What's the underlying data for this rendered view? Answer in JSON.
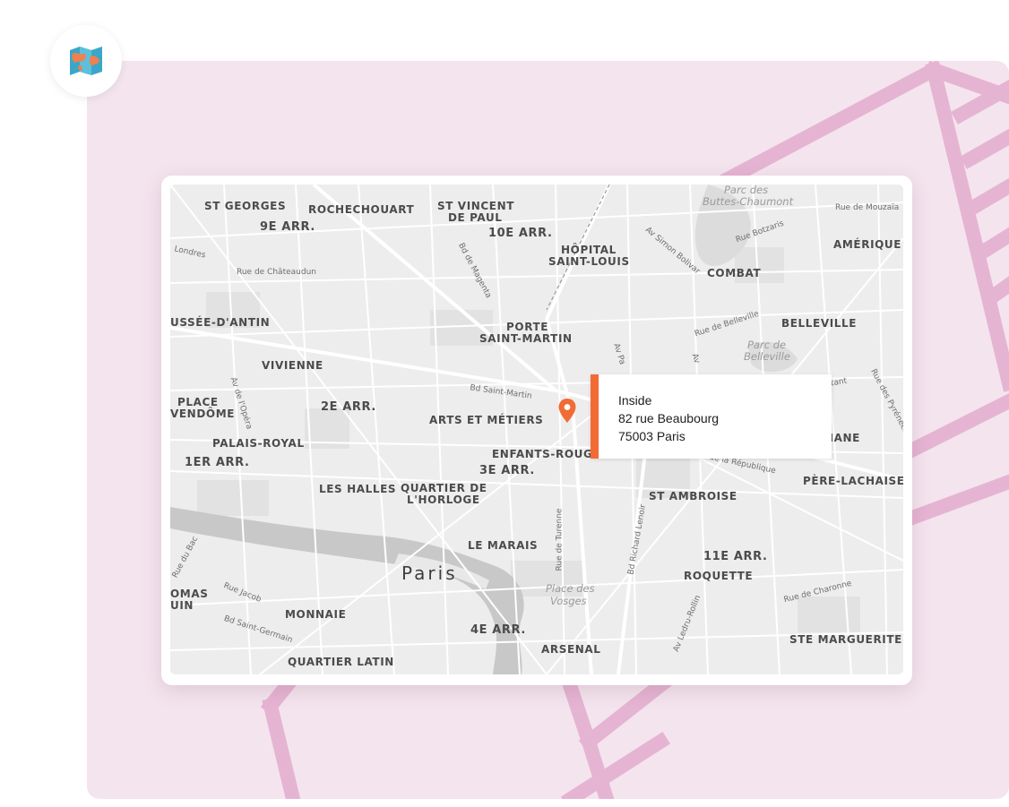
{
  "app_icon": {
    "icon": "folded-map-icon",
    "colors": {
      "map": "#3aa7c9",
      "land": "#f0804d"
    }
  },
  "colors": {
    "panel_bg": "#f4e4ee",
    "decor_lines": "#e6b4d3",
    "marker": "#f26b35",
    "card_bg": "#ffffff"
  },
  "map": {
    "city": "Paris",
    "areas": {
      "st_georges": "ST GEORGES",
      "rochechouart": "ROCHECHOUART",
      "st_vincent_1": "ST VINCENT",
      "st_vincent_2": "DE PAUL",
      "arr9": "9E ARR.",
      "arr10": "10E ARR.",
      "hopital_1": "HÔPITAL",
      "hopital_2": "SAINT-LOUIS",
      "amerique": "AMÉRIQUE",
      "combat": "COMBAT",
      "chaussee": "USSÉE-D'ANTIN",
      "porte_1": "PORTE",
      "porte_2": "SAINT-MARTIN",
      "belleville": "BELLEVILLE",
      "vivienne": "VIVIENNE",
      "place_1": "PLACE",
      "place_2": "VENDÔME",
      "arr2": "2E ARR.",
      "arts": "ARTS ET MÉTIERS",
      "palais": "PALAIS-ROYAL",
      "arr1": "1ER ARR.",
      "enfants": "ENFANTS-ROUGES",
      "arr3": "3E ARR.",
      "menilmontant": "NANE",
      "halles": "LES HALLES",
      "horloge_1": "QUARTIER DE",
      "horloge_2": "L'HORLOGE",
      "st_ambroise": "ST AMBROISE",
      "pere": "PÈRE-LACHAISE",
      "marais": "LE MARAIS",
      "arr11": "11E ARR.",
      "roquette": "ROQUETTE",
      "thomas_1": "OMAS",
      "thomas_2": "UIN",
      "monnaie": "MONNAIE",
      "arr4": "4E ARR.",
      "arsenal": "ARSENAL",
      "ste_marguerite": "STE MARGUERITE",
      "latin": "QUARTIER LATIN"
    },
    "parks": {
      "buttes_1": "Parc des",
      "buttes_2": "Buttes-Chaumont",
      "belleville_1": "Parc de",
      "belleville_2": "Belleville",
      "vosges_1": "Place des",
      "vosges_2": "Vosges"
    },
    "streets": {
      "mouzaia": "Rue de Mouzaïa",
      "botzaris": "Rue Botzaris",
      "londres": "Londres",
      "chateaudun": "Rue de Châteaudun",
      "magenta": "Bd de Magenta",
      "simon_bolivar": "Av Simon Bolivar",
      "rue_belleville": "Rue de Belleville",
      "bd_st_martin": "Bd Saint-Martin",
      "av_opera": "Av de l'Opéra",
      "ontant": "ontant",
      "pyrenees": "Rue des Pyrénées",
      "republique": "Av de la République",
      "turenne": "Rue de Turenne",
      "richard_lenoir": "Bd Richard Lenoir",
      "ledru_rollin": "Av Ledru-Rollin",
      "charonne": "Rue de Charonne",
      "rue_bac": "Rue du Bac",
      "jacob": "Rue Jacob",
      "st_germain": "Bd Saint-Germain",
      "av_pa": "Av Pa",
      "av_ro": "Av"
    },
    "marker": {
      "icon": "map-pin-icon",
      "lines": [
        "Inside",
        "82 rue Beaubourg",
        "75003 Paris"
      ]
    }
  }
}
